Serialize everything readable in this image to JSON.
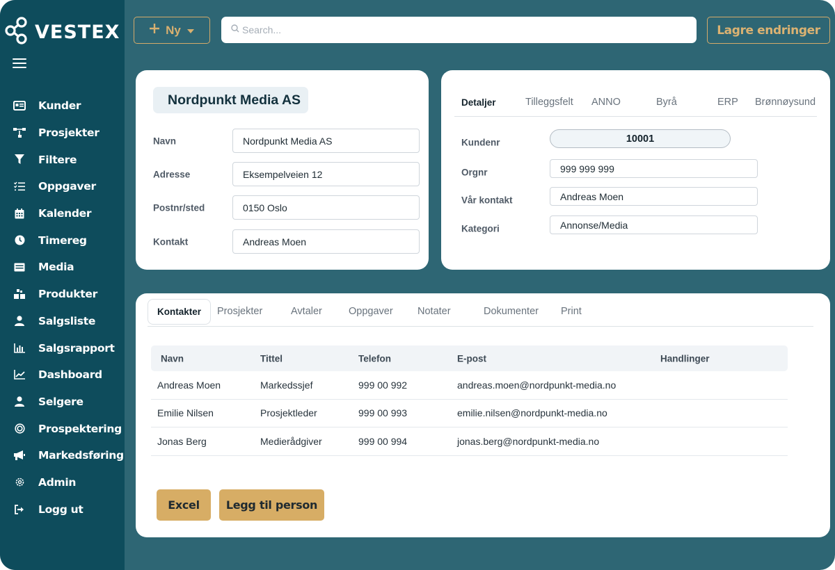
{
  "brand": {
    "name": "VESTEX"
  },
  "topbar": {
    "new_button": "Ny",
    "search_placeholder": "Search...",
    "save_button": "Lagre endringer"
  },
  "sidebar": {
    "items": [
      {
        "label": "Kunder",
        "icon": "id-card-icon"
      },
      {
        "label": "Prosjekter",
        "icon": "project-tree-icon"
      },
      {
        "label": "Filtere",
        "icon": "filter-icon"
      },
      {
        "label": "Oppgaver",
        "icon": "checklist-icon"
      },
      {
        "label": "Kalender",
        "icon": "calendar-icon"
      },
      {
        "label": "Timereg",
        "icon": "clock-icon"
      },
      {
        "label": "Media",
        "icon": "media-icon"
      },
      {
        "label": "Produkter",
        "icon": "boxes-icon"
      },
      {
        "label": "Salgsliste",
        "icon": "user-icon"
      },
      {
        "label": "Salgsrapport",
        "icon": "bar-chart-icon"
      },
      {
        "label": "Dashboard",
        "icon": "line-chart-icon"
      },
      {
        "label": "Selgere",
        "icon": "user-icon"
      },
      {
        "label": "Prospektering",
        "icon": "target-icon"
      },
      {
        "label": "Markedsføring",
        "icon": "megaphone-icon"
      },
      {
        "label": "Admin",
        "icon": "gear-icon"
      },
      {
        "label": "Logg ut",
        "icon": "logout-icon"
      }
    ]
  },
  "company": {
    "name": "Nordpunkt Media AS",
    "fields": [
      {
        "label": "Navn",
        "value": "Nordpunkt Media AS"
      },
      {
        "label": "Adresse",
        "value": "Eksempelveien 12"
      },
      {
        "label": "Postnr/sted",
        "value": "0150 Oslo"
      },
      {
        "label": "Kontakt",
        "value": "Andreas Moen"
      }
    ]
  },
  "details": {
    "tabs": [
      "Detaljer",
      "Tilleggsfelt",
      "ANNO",
      "Byrå",
      "ERP",
      "Brønnøysund"
    ],
    "active_tab": "Detaljer",
    "fields": [
      {
        "label": "Kundenr",
        "value": "10001"
      },
      {
        "label": "Orgnr",
        "value": "999 999 999"
      },
      {
        "label": "Vår kontakt",
        "value": "Andreas Moen"
      },
      {
        "label": "Kategori",
        "value": "Annonse/Media"
      }
    ]
  },
  "contacts": {
    "tabs": [
      "Kontakter",
      "Prosjekter",
      "Avtaler",
      "Oppgaver",
      "Notater",
      "Dokumenter",
      "Print"
    ],
    "active_tab": "Kontakter",
    "columns": [
      "Navn",
      "Tittel",
      "Telefon",
      "E-post",
      "Handlinger"
    ],
    "rows": [
      {
        "name": "Andreas Moen",
        "title": "Markedssjef",
        "phone": "999 00 992",
        "email": "andreas.moen@nordpunkt-media.no"
      },
      {
        "name": "Emilie Nilsen",
        "title": "Prosjektleder",
        "phone": "999 00 993",
        "email": "emilie.nilsen@nordpunkt-media.no"
      },
      {
        "name": "Jonas Berg",
        "title": "Medierådgiver",
        "phone": "999 00 994",
        "email": "jonas.berg@nordpunkt-media.no"
      }
    ],
    "excel_button": "Excel",
    "add_button": "Legg til person"
  },
  "colors": {
    "background": "#2e6674",
    "sidebar": "#0e4c5c",
    "accent_gold": "#d7ad65",
    "card": "#ffffff"
  }
}
